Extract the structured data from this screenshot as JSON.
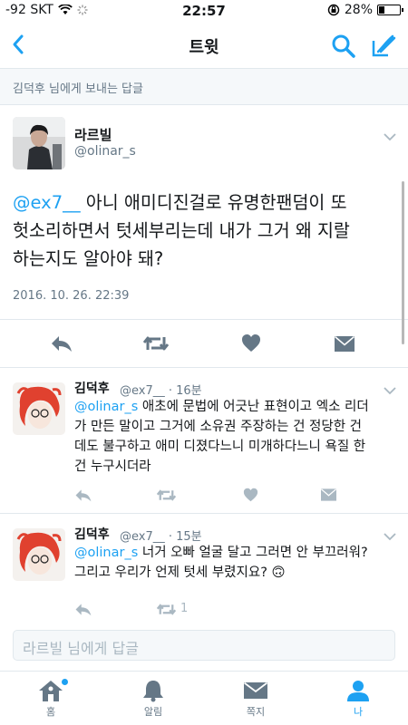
{
  "status_bar": {
    "signal": "-92 SKT",
    "time": "22:57",
    "battery": "28%",
    "battery_level": 0.28
  },
  "nav": {
    "title": "트윗"
  },
  "reply_context": "김덕후 님에게 보내는 답글",
  "main_tweet": {
    "name": "라르빌",
    "handle": "@olinar_s",
    "mention": "@ex7__",
    "text_line1": " 아니 애미디진걸로 유명한팬덤이 또",
    "text_line2": "헛소리하면서 텃세부리는데 내가 그거 왜 지랄",
    "text_line3": "하는지도 알아야 돼?",
    "timestamp": "2016. 10. 26. 22:39"
  },
  "replies": [
    {
      "name": "김덕후",
      "handle": "@ex7__",
      "age": "· 16분",
      "mention": "@olinar_s",
      "text_line1": " 애초에 문법에 어긋난 표현이고 엑소 리더",
      "text_line2": "가 만든 말이고 그거에 소유권 주장하는 건 정당한 건",
      "text_line3": "데도 불구하고 애미 디졌다느니 미개하다느니 욕질 한",
      "text_line4": "건 누구시더라"
    },
    {
      "name": "김덕후",
      "handle": "@ex7__",
      "age": "· 15분",
      "mention": "@olinar_s",
      "text_line1": " 너거 오빠 얼굴 달고 그러면 안 부끄러워?",
      "text_line2": "그리고 우리가 언제 텃세 부렸지요? 🙃",
      "retweet_count": "1"
    }
  ],
  "reply_input": {
    "placeholder": "라르빌 님에게 답글"
  },
  "tabs": [
    {
      "label": "홈"
    },
    {
      "label": "알림"
    },
    {
      "label": "쪽지"
    },
    {
      "label": "나"
    }
  ],
  "colors": {
    "accent": "#1da1f2",
    "icon": "#657786",
    "faded_icon": "#aab8c2"
  }
}
